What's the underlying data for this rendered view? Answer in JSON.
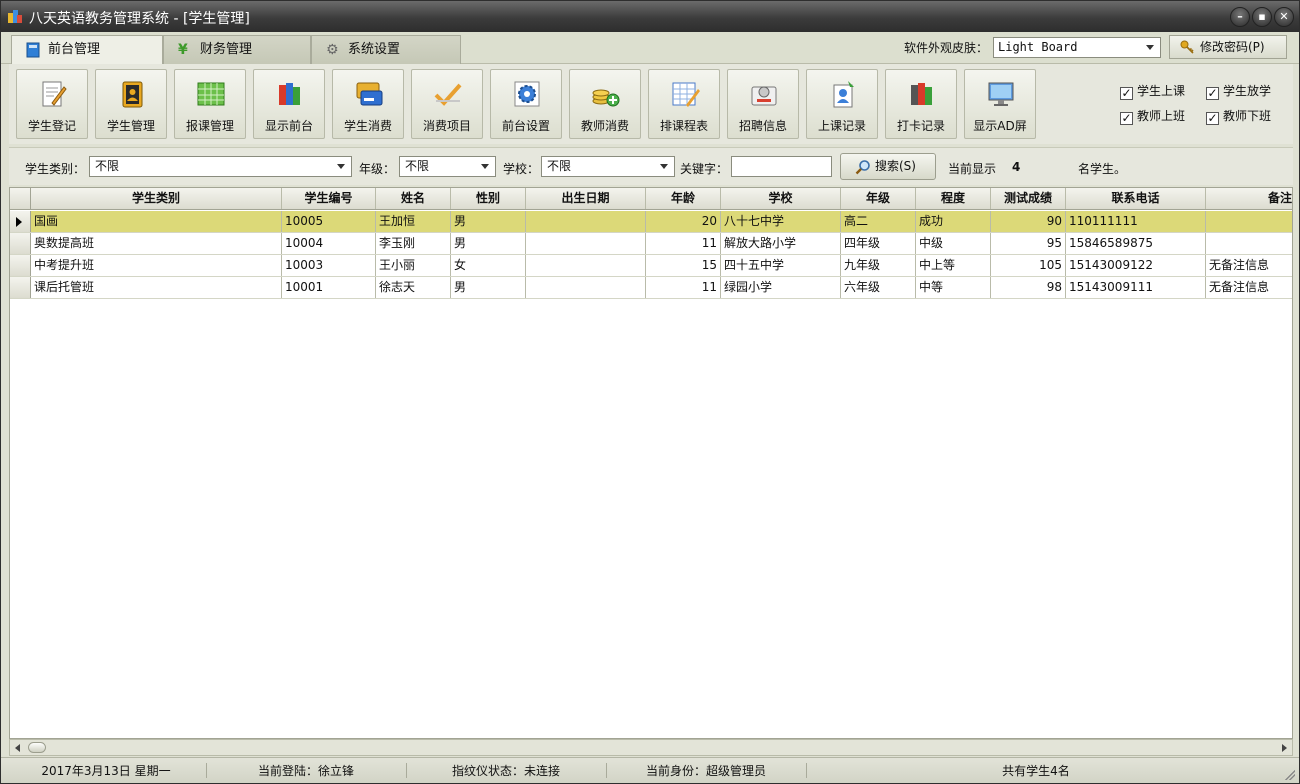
{
  "window": {
    "title": "八天英语教务管理系统 - [学生管理]"
  },
  "tabs": [
    {
      "label": "前台管理",
      "active": true,
      "icon": "book-icon"
    },
    {
      "label": "财务管理",
      "active": false,
      "icon": "yen-icon"
    },
    {
      "label": "系统设置",
      "active": false,
      "icon": "gear-icon"
    }
  ],
  "skin": {
    "label": "软件外观皮肤：",
    "value": "Light Board"
  },
  "change_password_label": "修改密码(P)",
  "toolbar": {
    "buttons": [
      {
        "label": "学生登记",
        "icon": "register-icon"
      },
      {
        "label": "学生管理",
        "icon": "contacts-icon"
      },
      {
        "label": "报课管理",
        "icon": "spreadsheet-icon"
      },
      {
        "label": "显示前台",
        "icon": "books-icon"
      },
      {
        "label": "学生消费",
        "icon": "card-icon"
      },
      {
        "label": "消费项目",
        "icon": "checkmark-icon"
      },
      {
        "label": "前台设置",
        "icon": "settings-icon"
      },
      {
        "label": "教师消费",
        "icon": "coins-icon"
      },
      {
        "label": "排课程表",
        "icon": "schedule-icon"
      },
      {
        "label": "招聘信息",
        "icon": "recruit-icon"
      },
      {
        "label": "上课记录",
        "icon": "record-icon"
      },
      {
        "label": "打卡记录",
        "icon": "clock-in-icon"
      },
      {
        "label": "显示AD屏",
        "icon": "monitor-icon"
      }
    ],
    "checks": [
      {
        "label": "学生上课",
        "checked": true
      },
      {
        "label": "学生放学",
        "checked": true
      },
      {
        "label": "教师上班",
        "checked": true
      },
      {
        "label": "教师下班",
        "checked": true
      }
    ]
  },
  "filter": {
    "category_label": "学生类别：",
    "category_value": "不限",
    "grade_label": "年级：",
    "grade_value": "不限",
    "school_label": "学校：",
    "school_value": "不限",
    "keyword_label": "关键字：",
    "keyword_value": "",
    "search_label": "搜索(S)",
    "current_label": "当前显示",
    "current_count": "4",
    "current_suffix": "名学生。"
  },
  "table": {
    "columns": [
      "学生类别",
      "学生编号",
      "姓名",
      "性别",
      "出生日期",
      "年龄",
      "学校",
      "年级",
      "程度",
      "测试成绩",
      "联系电话",
      "备注"
    ],
    "rows": [
      {
        "cells": [
          "国画",
          "10005",
          "王加恒",
          "男",
          "",
          "20",
          "八十七中学",
          "高二",
          "成功",
          "90",
          "110111111",
          ""
        ],
        "selected": true
      },
      {
        "cells": [
          "奥数提高班",
          "10004",
          "李玉刚",
          "男",
          "",
          "11",
          "解放大路小学",
          "四年级",
          "中级",
          "95",
          "15846589875",
          ""
        ],
        "selected": false
      },
      {
        "cells": [
          "中考提升班",
          "10003",
          "王小丽",
          "女",
          "",
          "15",
          "四十五中学",
          "九年级",
          "中上等",
          "105",
          "15143009122",
          "无备注信息"
        ],
        "selected": false
      },
      {
        "cells": [
          "课后托管班",
          "10001",
          "徐志天",
          "男",
          "",
          "11",
          "绿园小学",
          "六年级",
          "中等",
          "98",
          "15143009111",
          "无备注信息"
        ],
        "selected": false
      }
    ]
  },
  "status": {
    "date": "2017年3月13日 星期一",
    "login": "当前登陆：徐立锋",
    "fingerprint": "指纹仪状态：未连接",
    "identity": "当前身份：超级管理员",
    "total": "共有学生4名"
  }
}
